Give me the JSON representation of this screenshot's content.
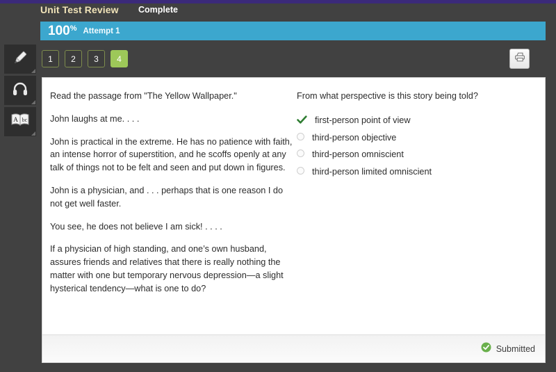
{
  "theme": {
    "top_strip_color": "#3b2a7a",
    "page_bg": "#414141",
    "attempt_bar_color": "#3ca7ce",
    "active_nav_color": "#9dc859",
    "nav_border_color": "#7e8c4d",
    "title_color": "#efe2b8",
    "correct_check_color": "#2f7d32",
    "submitted_badge_color": "#6ab04c"
  },
  "header": {
    "title": "Unit Test Review",
    "status": "Complete"
  },
  "attempt": {
    "score": "100",
    "percent_symbol": "%",
    "label": "Attempt 1"
  },
  "toolbar": {
    "items": [
      {
        "icon": "pencil-icon",
        "name": "highlighter-tool"
      },
      {
        "icon": "headphones-icon",
        "name": "audio-tool"
      },
      {
        "icon": "dictionary-book-icon",
        "name": "dictionary-tool"
      }
    ]
  },
  "question_nav": {
    "buttons": [
      {
        "label": "1",
        "active": false
      },
      {
        "label": "2",
        "active": false
      },
      {
        "label": "3",
        "active": false
      },
      {
        "label": "4",
        "active": true
      }
    ]
  },
  "print_button": {
    "icon": "printer-icon"
  },
  "passage": {
    "paragraphs": [
      "Read the passage from \"The Yellow Wallpaper.\"",
      "John laughs at me. . . .",
      "John is practical in the extreme. He has no patience with faith, an intense horror of superstition, and he scoffs openly at any talk of things not to be felt and seen and put down in figures.",
      "John is a physician, and . . . perhaps that is one reason I do not get well faster.",
      "You see, he does not believe I am sick! . . . .",
      "If a physician of high standing, and one’s own husband, assures friends and relatives that there is really nothing the matter with one but temporary nervous depression—a slight hysterical tendency—what is one to do?"
    ]
  },
  "question": {
    "text": "From what perspective is this story being told?",
    "options": [
      {
        "label": "first-person point of view",
        "state": "correct"
      },
      {
        "label": "third-person objective",
        "state": "unselected"
      },
      {
        "label": "third-person omniscient",
        "state": "unselected"
      },
      {
        "label": "third-person limited omniscient",
        "state": "unselected"
      }
    ]
  },
  "footer": {
    "submitted_label": "Submitted",
    "submitted_icon": "check-circle-icon"
  }
}
